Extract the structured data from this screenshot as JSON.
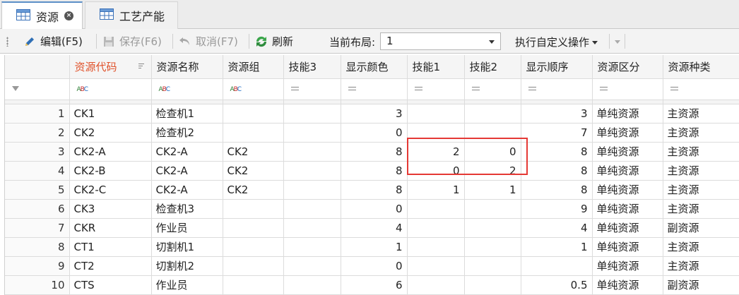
{
  "tabs": [
    {
      "label": "资源",
      "icon": "table-icon",
      "active": true,
      "closable": true
    },
    {
      "label": "工艺产能",
      "icon": "table-icon",
      "active": false,
      "closable": false
    }
  ],
  "toolbar": {
    "edit_label": "编辑(F5)",
    "save_label": "保存(F6)",
    "cancel_label": "取消(F7)",
    "refresh_label": "刷新",
    "layout_label": "当前布局:",
    "layout_value": "1",
    "custom_op_label": "执行自定义操作"
  },
  "grid": {
    "columns": [
      "资源代码",
      "资源名称",
      "资源组",
      "技能3",
      "显示颜色",
      "技能1",
      "技能2",
      "显示顺序",
      "资源区分",
      "资源种类"
    ],
    "sorted_column": "资源代码",
    "rows": [
      {
        "n": "1",
        "code": "CK1",
        "name": "检查机1",
        "group": "",
        "skill3": "",
        "color": "3",
        "skill1": "",
        "skill2": "",
        "order": "3",
        "kind": "单纯资源",
        "type": "主资源"
      },
      {
        "n": "2",
        "code": "CK2",
        "name": "检查机2",
        "group": "",
        "skill3": "",
        "color": "0",
        "skill1": "",
        "skill2": "",
        "order": "7",
        "kind": "单纯资源",
        "type": "主资源"
      },
      {
        "n": "3",
        "code": "CK2-A",
        "name": "CK2-A",
        "group": "CK2",
        "skill3": "",
        "color": "8",
        "skill1": "2",
        "skill2": "0",
        "order": "8",
        "kind": "单纯资源",
        "type": "主资源"
      },
      {
        "n": "4",
        "code": "CK2-B",
        "name": "CK2-A",
        "group": "CK2",
        "skill3": "",
        "color": "8",
        "skill1": "0",
        "skill2": "2",
        "order": "8",
        "kind": "单纯资源",
        "type": "主资源"
      },
      {
        "n": "5",
        "code": "CK2-C",
        "name": "CK2-A",
        "group": "CK2",
        "skill3": "",
        "color": "8",
        "skill1": "1",
        "skill2": "1",
        "order": "8",
        "kind": "单纯资源",
        "type": "主资源"
      },
      {
        "n": "6",
        "code": "CK3",
        "name": "检查机3",
        "group": "",
        "skill3": "",
        "color": "0",
        "skill1": "",
        "skill2": "",
        "order": "9",
        "kind": "单纯资源",
        "type": "主资源"
      },
      {
        "n": "7",
        "code": "CKR",
        "name": "作业员",
        "group": "",
        "skill3": "",
        "color": "4",
        "skill1": "",
        "skill2": "",
        "order": "4",
        "kind": "单纯资源",
        "type": "副资源"
      },
      {
        "n": "8",
        "code": "CT1",
        "name": "切割机1",
        "group": "",
        "skill3": "",
        "color": "1",
        "skill1": "",
        "skill2": "",
        "order": "1",
        "kind": "单纯资源",
        "type": "主资源"
      },
      {
        "n": "9",
        "code": "CT2",
        "name": "切割机2",
        "group": "",
        "skill3": "",
        "color": "0",
        "skill1": "",
        "skill2": "",
        "order": "",
        "kind": "单纯资源",
        "type": "主资源"
      },
      {
        "n": "10",
        "code": "CTS",
        "name": "作业员",
        "group": "",
        "skill3": "",
        "color": "6",
        "skill1": "",
        "skill2": "",
        "order": "0.5",
        "kind": "单纯资源",
        "type": "副资源"
      }
    ]
  },
  "colors": {
    "accent": "#5b8fc7",
    "sorted_header": "#e0522b",
    "highlight": "#e53935"
  }
}
